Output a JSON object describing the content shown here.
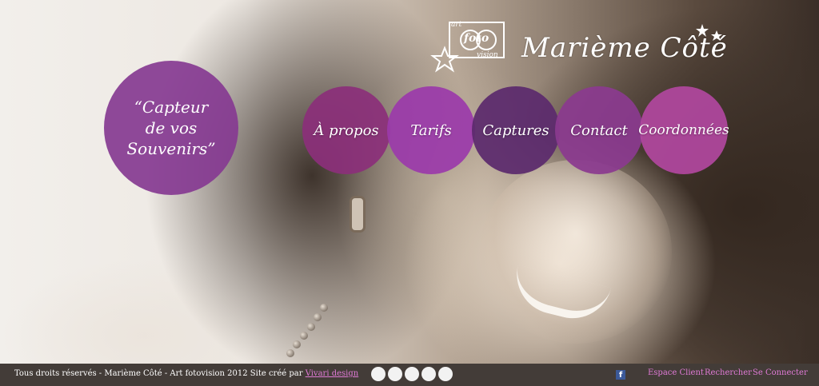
{
  "header": {
    "brand_name": "Marième Côté",
    "logo_word_art": "art",
    "logo_word_foto": "foto",
    "logo_word_vision": "vision"
  },
  "quote": {
    "text": "“Capteur\nde vos\nSouvenirs”",
    "color": "#853a91"
  },
  "nav": [
    {
      "label": "À propos",
      "color": "#8b2f7a"
    },
    {
      "label": "Tarifs",
      "color": "#9b3aaa"
    },
    {
      "label": "Captures",
      "color": "#5b2a6d"
    },
    {
      "label": "Contact",
      "color": "#8b3a8f"
    },
    {
      "label": "Coordonnées",
      "color": "#b0479e"
    }
  ],
  "footer": {
    "copyright": "Tous droits réservés - Marième Côté - Art fotovision 2012 Site créé par",
    "credit_link": "Vivari design",
    "facebook_icon_glyph": "f",
    "links": [
      "Espace Client",
      "Rechercher",
      "Se Connecter"
    ],
    "slide_dots": 5
  }
}
